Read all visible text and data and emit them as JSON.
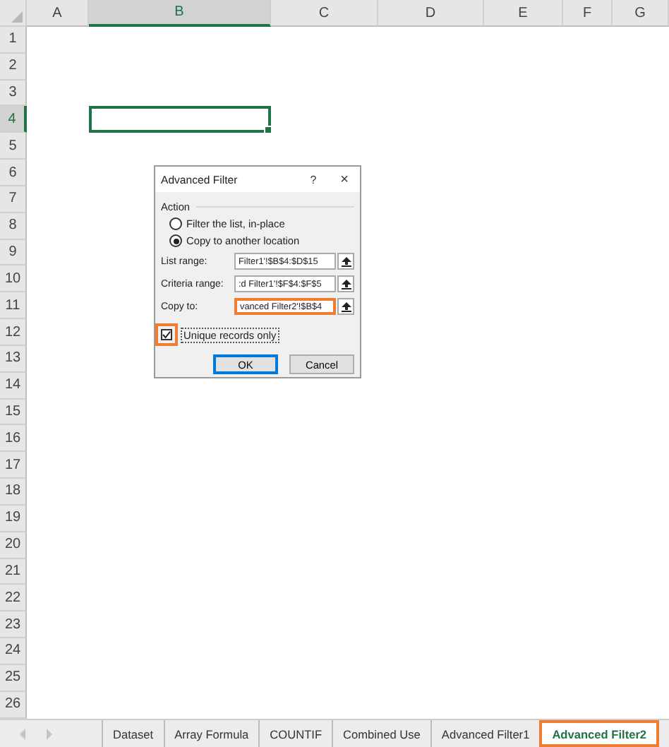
{
  "columns": [
    {
      "label": "A",
      "selected": false
    },
    {
      "label": "B",
      "selected": true
    },
    {
      "label": "C",
      "selected": false
    },
    {
      "label": "D",
      "selected": false
    },
    {
      "label": "E",
      "selected": false
    },
    {
      "label": "F",
      "selected": false
    },
    {
      "label": "G",
      "selected": false
    }
  ],
  "rows": [
    {
      "label": "1",
      "selected": false
    },
    {
      "label": "2",
      "selected": false
    },
    {
      "label": "3",
      "selected": false
    },
    {
      "label": "4",
      "selected": true
    },
    {
      "label": "5",
      "selected": false
    },
    {
      "label": "6",
      "selected": false
    },
    {
      "label": "7",
      "selected": false
    },
    {
      "label": "8",
      "selected": false
    },
    {
      "label": "9",
      "selected": false
    },
    {
      "label": "10",
      "selected": false
    },
    {
      "label": "11",
      "selected": false
    },
    {
      "label": "12",
      "selected": false
    },
    {
      "label": "13",
      "selected": false
    },
    {
      "label": "14",
      "selected": false
    },
    {
      "label": "15",
      "selected": false
    },
    {
      "label": "16",
      "selected": false
    },
    {
      "label": "17",
      "selected": false
    },
    {
      "label": "18",
      "selected": false
    },
    {
      "label": "19",
      "selected": false
    },
    {
      "label": "20",
      "selected": false
    },
    {
      "label": "21",
      "selected": false
    },
    {
      "label": "22",
      "selected": false
    },
    {
      "label": "23",
      "selected": false
    },
    {
      "label": "24",
      "selected": false
    },
    {
      "label": "25",
      "selected": false
    },
    {
      "label": "26",
      "selected": false
    }
  ],
  "dialog": {
    "title": "Advanced Filter",
    "help": "?",
    "close": "×",
    "group_label": "Action",
    "options": [
      {
        "label": "Filter the list, in-place",
        "selected": false
      },
      {
        "label": "Copy to another location",
        "selected": true
      }
    ],
    "fields": [
      {
        "label": "List range:",
        "value": "Filter1'!$B$4:$D$15",
        "highlighted": false
      },
      {
        "label": "Criteria range:",
        "value": ":d Filter1'!$F$4:$F$5",
        "highlighted": false
      },
      {
        "label": "Copy to:",
        "value": "vanced Filter2'!$B$4",
        "highlighted": true
      }
    ],
    "checkbox": {
      "label": "Unique records only",
      "checked": true,
      "highlighted": true
    },
    "buttons": [
      {
        "label": "OK",
        "default": true
      },
      {
        "label": "Cancel",
        "default": false
      }
    ]
  },
  "sheet_tabs": [
    {
      "label": "Dataset",
      "selected": false,
      "highlighted": false
    },
    {
      "label": "Array Formula",
      "selected": false,
      "highlighted": false
    },
    {
      "label": "COUNTIF",
      "selected": false,
      "highlighted": false
    },
    {
      "label": "Combined Use",
      "selected": false,
      "highlighted": false
    },
    {
      "label": "Advanced Filter1",
      "selected": false,
      "highlighted": false
    },
    {
      "label": "Advanced Filter2",
      "selected": true,
      "highlighted": true
    }
  ]
}
